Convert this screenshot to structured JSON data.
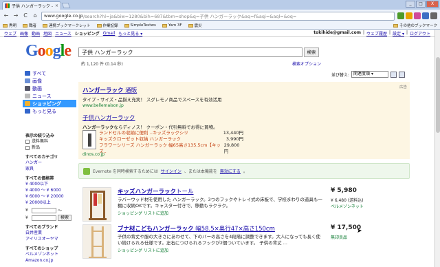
{
  "browser": {
    "tab_title": "子供 ハンガーラック - Googl...",
    "tab_close": "×",
    "url_host": "www.google.co.jp",
    "url_rest": "/search?hl=ja&biw=1280&bih=687&tbm=shop&q=子供 ハンガーラック&aq=f&aqi=&aql=&oq=",
    "nav": {
      "back": "←",
      "forward": "→",
      "reload": "C",
      "home": "⌂"
    },
    "window": {
      "minimize": "_",
      "maximize": "□",
      "close": "X"
    }
  },
  "bookmarks": [
    {
      "label": "秀明"
    },
    {
      "label": "職者"
    },
    {
      "label": "連携ブックマークレット"
    },
    {
      "label": "作業記録"
    },
    {
      "label": "SimpleTextws"
    },
    {
      "label": "Yam 3F"
    },
    {
      "label": "震災"
    }
  ],
  "bookmarks_right": "その他のブックマーク",
  "gbar": {
    "links": [
      "ウェブ",
      "画像",
      "動画",
      "地図",
      "ニュース",
      "ショッピング",
      "Gmail",
      "もっと見る ▾"
    ],
    "active": "ショッピング",
    "email": "tokihide@gmail.com",
    "right_links": [
      "ウェブ履歴",
      "設定 ▾",
      "ログアウト"
    ]
  },
  "logo": {
    "G": "G",
    "o1": "o",
    "o2": "o",
    "g": "g",
    "l": "l",
    "e": "e"
  },
  "search": {
    "query": "子供 ハンガーラック",
    "button": "検索",
    "result_count": "約 1,120 件 (0.14 秒)",
    "options": "検索オプション"
  },
  "left_nav": [
    {
      "label": "すべて",
      "color": "#3366cc"
    },
    {
      "label": "画像",
      "color": "#6b8fd6"
    },
    {
      "label": "動画",
      "color": "#556"
    },
    {
      "label": "ニュース",
      "color": "#bbb"
    },
    {
      "label": "ショッピング",
      "color": "#f0b030"
    },
    {
      "label": "もっと見る",
      "color": "#3366cc"
    }
  ],
  "filters": {
    "narrow_head": "表示の絞り込み",
    "checks": [
      "送料無料",
      "新品"
    ],
    "category_head": "すべてのカテゴリ",
    "categories": [
      "ハンガー",
      "家具"
    ],
    "price_head": "すべての価格帯",
    "prices": [
      "¥ 4000以下",
      "¥ 4000 ～ ¥ 6000",
      "¥ 6000 ～ ¥ 20000",
      "¥ 20000以上"
    ],
    "yen": "¥",
    "tilde": "～",
    "price_button": "検索",
    "brand_head": "すべてのブランド",
    "brands": [
      "白井産業",
      "アイリスオーヤマ"
    ],
    "shop_head": "すべてのショップ",
    "shops": [
      "ベルメゾンネット"
    ],
    "more_shop": "Amazon.co.jp"
  },
  "sort": {
    "label": "並び替え:",
    "value": "関連度順 ▾"
  },
  "ads": {
    "label": "広告",
    "ad1": {
      "title_bold": "ハンガーラック",
      "title_rest": " 通販",
      "desc": "タイプ・サイズ・品揃え充実！ スグレモノ商品でスペースを有効活用",
      "url": "www.bellemaison.jp"
    },
    "ad2": {
      "title": "子供ハンガーラック",
      "desc_bold": "ハンガーラック",
      "desc_rest": "ならディノス！ クーポン・代引無料でお得に買物。",
      "products": [
        {
          "name": "ランドセルの収納に便利 ‥キッズラックシリ",
          "price": "13,440円"
        },
        {
          "name": "キッズクローゼット収納 ハンガーラック",
          "price": "3,990円"
        },
        {
          "name": "フラワーシリーズ ハンガーラック 幅65高さ135.5cm【キッズ‥",
          "price": "29,800円"
        }
      ],
      "url": "dinos.co.jp"
    }
  },
  "evernote": {
    "text": "Evernote を同時検索するためには",
    "link1": "サインイン",
    "mid": "、または本機能を",
    "link2": "無効にする",
    "end": "。"
  },
  "products": [
    {
      "title_bold": "キッズハンガーラック",
      "title_rest": "トール",
      "desc": "ラバーウッド材を使用した ハンガーラック。3つのフックやトレイ式の床板で、学校まわりの道具も一棚に収納OKです。キャスター付きで、移動もラクラク。",
      "add": "ショッピング リストに追加",
      "price": "¥ 5,980",
      "ship": "¥ 6,480 (送料込)",
      "store": "ベルメゾンネット"
    },
    {
      "title_bold": "ブナ材こどもハンガーラック",
      "title_rest": " 幅58.5×奥行47×高さ150cm",
      "desc": "子供の背丈や服の大きさにあわせて、下のバーの高さを4段階に調整できます。大人になっても長く使い続けられる仕様です。左右につけられるフックが2個ついています。 子供の背丈 ...",
      "add": "ショッピング リストに追加",
      "price": "¥ 17,500",
      "ship": "",
      "store": "無印良品"
    }
  ]
}
